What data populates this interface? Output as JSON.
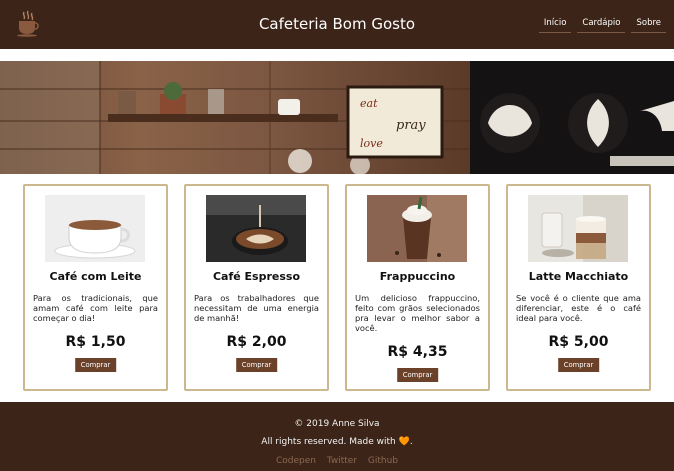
{
  "header": {
    "logo_icon": "coffee-cup-icon",
    "title": "Cafeteria Bom Gosto",
    "nav": [
      {
        "label": "Início"
      },
      {
        "label": "Cardápio"
      },
      {
        "label": "Sobre"
      }
    ]
  },
  "banner": {
    "board_lines": [
      "eat",
      "pray",
      "love"
    ]
  },
  "products": [
    {
      "name": "Café com Leite",
      "description": "Para os tradicionais, que amam café com leite para começar o dia!",
      "price": "R$ 1,50",
      "button": "Comprar"
    },
    {
      "name": "Café Espresso",
      "description": "Para os trabalhadores que necessitam de uma energia de manhã!",
      "price": "R$ 2,00",
      "button": "Comprar"
    },
    {
      "name": "Frappuccino",
      "description": "Um delicioso frappuccino, feito com grãos selecionados pra levar o melhor sabor a você.",
      "price": "R$ 4,35",
      "button": "Comprar"
    },
    {
      "name": "Latte Macchiato",
      "description": "Se você é o cliente que ama diferenciar, este é o café ideal para você.",
      "price": "R$ 5,00",
      "button": "Comprar"
    }
  ],
  "footer": {
    "copyright": "© 2019 Anne Silva",
    "made_prefix": "All rights reserved. Made with",
    "heart": "🧡",
    "made_suffix": ".",
    "links": [
      {
        "label": "Codepen"
      },
      {
        "label": "Twitter"
      },
      {
        "label": "Github"
      }
    ]
  },
  "colors": {
    "header_bg": "#3c2418",
    "card_border": "#cbb88f",
    "button_bg": "#6b4129",
    "footer_link": "#8a6a50"
  }
}
